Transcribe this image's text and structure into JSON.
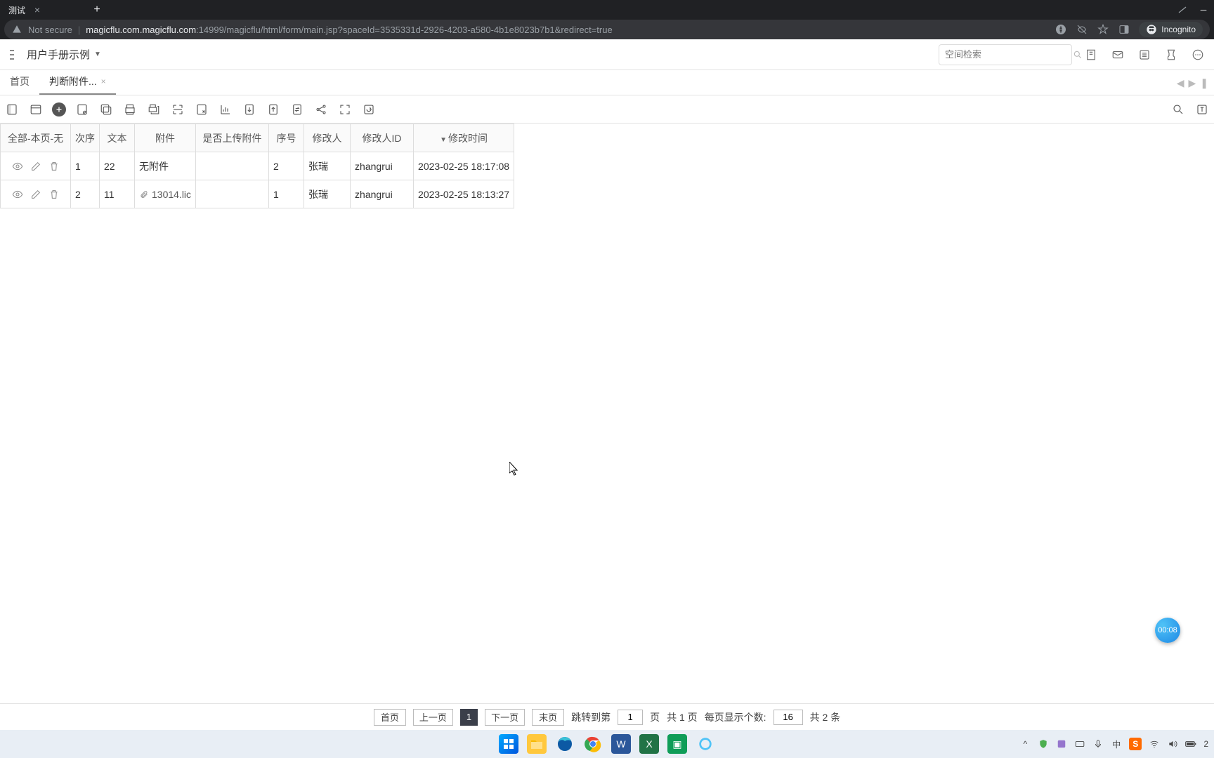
{
  "browser": {
    "tab_title": "测试",
    "not_secure": "Not secure",
    "url_host": "magicflu.com.magicflu.com",
    "url_port_path": ":14999/magicflu/html/form/main.jsp?spaceId=3535331d-2926-4203-a580-4b1e8023b7b1&redirect=true",
    "incognito_label": "Incognito"
  },
  "header": {
    "space_name": "用户手册示例",
    "search_placeholder": "空间检索"
  },
  "page_tabs": {
    "home": "首页",
    "active": "判断附件..."
  },
  "columns": {
    "actions": "全部-本页-无",
    "order": "次序",
    "text": "文本",
    "attachment": "附件",
    "uploaded": "是否上传附件",
    "seq": "序号",
    "modifier": "修改人",
    "modifier_id": "修改人ID",
    "mod_time": "修改时间"
  },
  "rows": [
    {
      "order": "1",
      "text": "22",
      "attachment": "无附件",
      "attachment_is_file": false,
      "uploaded": "",
      "seq": "2",
      "modifier": "张瑞",
      "modifier_id": "zhangrui",
      "mod_time": "2023-02-25 18:17:08"
    },
    {
      "order": "2",
      "text": "11",
      "attachment": "13014.lic",
      "attachment_is_file": true,
      "uploaded": "",
      "seq": "1",
      "modifier": "张瑞",
      "modifier_id": "zhangrui",
      "mod_time": "2023-02-25 18:13:27"
    }
  ],
  "pagination": {
    "first": "首页",
    "prev": "上一页",
    "current": "1",
    "next": "下一页",
    "last": "末页",
    "jump_label": "跳转到第",
    "jump_value": "1",
    "page_unit": "页",
    "total_pages": "共 1 页",
    "per_page_label": "每页显示个数:",
    "per_page_value": "16",
    "total_records": "共 2 条"
  },
  "timer": "00:08"
}
